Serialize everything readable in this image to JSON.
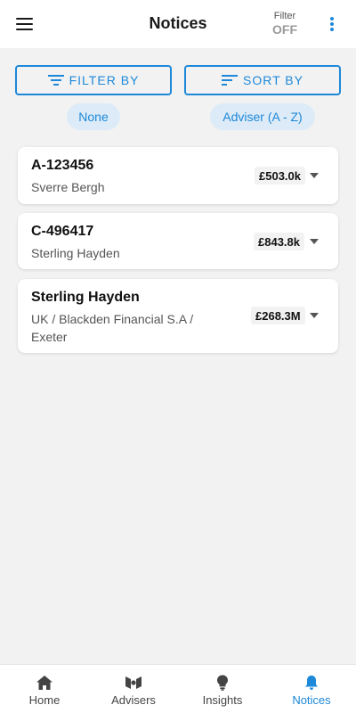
{
  "header": {
    "title": "Notices",
    "filter_label": "Filter",
    "filter_value": "OFF",
    "menu_icon": "hamburger-menu-icon",
    "more_icon": "kebab-menu-icon"
  },
  "controls": {
    "filter_button": "FILTER BY",
    "sort_button": "SORT BY",
    "filter_chip": "None",
    "sort_chip": "Adviser (A - Z)",
    "filter_icon": "filter-lines-icon",
    "sort_icon": "sort-lines-icon"
  },
  "notices": [
    {
      "ref": "A-123456",
      "subtitle": "Sverre Bergh",
      "amount": "£503.0k"
    },
    {
      "ref": "C-496417",
      "subtitle": "Sterling Hayden",
      "amount": "£843.8k"
    },
    {
      "ref": "Sterling Hayden",
      "subtitle": "UK / Blackden Financial S.A / Exeter",
      "amount": "£268.3M"
    }
  ],
  "bottom_nav": {
    "items": [
      {
        "label": "Home",
        "icon": "home-icon",
        "active": false
      },
      {
        "label": "Advisers",
        "icon": "advisers-icon",
        "active": false
      },
      {
        "label": "Insights",
        "icon": "lightbulb-icon",
        "active": false
      },
      {
        "label": "Notices",
        "icon": "bell-icon",
        "active": true
      }
    ]
  },
  "colors": {
    "accent": "#1e88d9",
    "background": "#f2f2f2",
    "chip_background": "#dcebf7",
    "muted": "#9a9a9a"
  }
}
